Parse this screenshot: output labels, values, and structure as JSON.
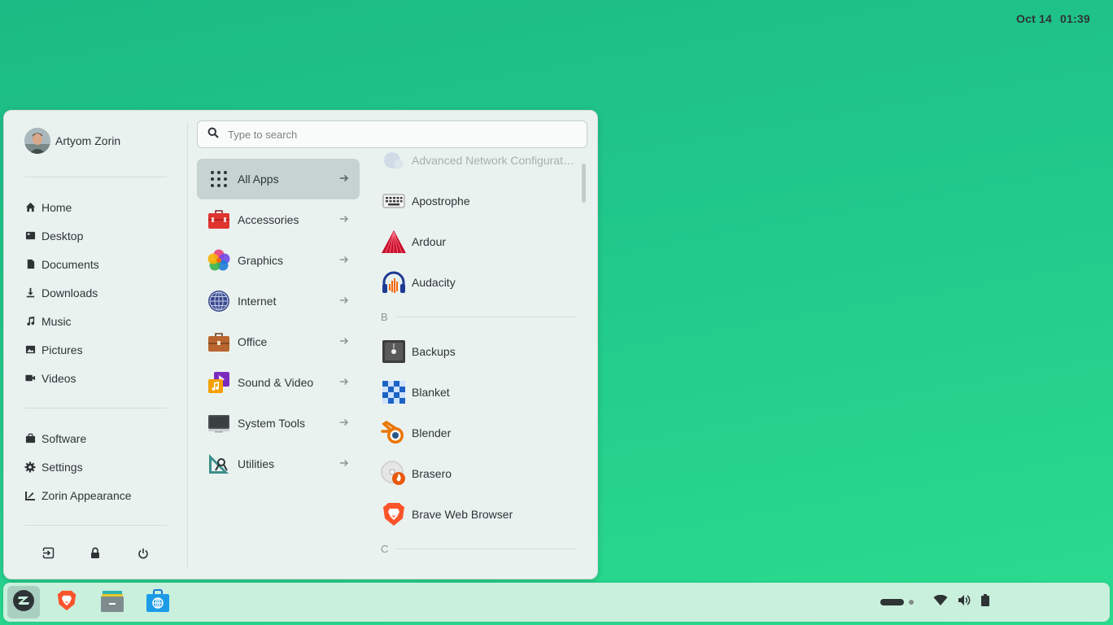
{
  "user": {
    "name": "Artyom Zorin"
  },
  "places": [
    {
      "label": "Home",
      "icon": "home-icon"
    },
    {
      "label": "Desktop",
      "icon": "desktop-icon"
    },
    {
      "label": "Documents",
      "icon": "document-icon"
    },
    {
      "label": "Downloads",
      "icon": "download-icon"
    },
    {
      "label": "Music",
      "icon": "music-icon"
    },
    {
      "label": "Pictures",
      "icon": "picture-icon"
    },
    {
      "label": "Videos",
      "icon": "video-icon"
    }
  ],
  "system": [
    {
      "label": "Software",
      "icon": "software-bag-icon"
    },
    {
      "label": "Settings",
      "icon": "gear-icon"
    },
    {
      "label": "Zorin Appearance",
      "icon": "appearance-icon"
    }
  ],
  "session": [
    "log-out-icon",
    "lock-icon",
    "power-icon"
  ],
  "search": {
    "placeholder": "Type to search"
  },
  "categories": [
    {
      "label": "All Apps",
      "active": true
    },
    {
      "label": "Accessories"
    },
    {
      "label": "Graphics"
    },
    {
      "label": "Internet"
    },
    {
      "label": "Office"
    },
    {
      "label": "Sound & Video"
    },
    {
      "label": "System Tools"
    },
    {
      "label": "Utilities"
    }
  ],
  "apps": {
    "partial_top": "Advanced Network Configurat…",
    "a_items": [
      "Apostrophe",
      "Ardour",
      "Audacity"
    ],
    "letter_b": "B",
    "b_items": [
      "Backups",
      "Blanket",
      "Blender",
      "Brasero",
      "Brave Web Browser"
    ],
    "letter_c": "C"
  },
  "taskbar": {
    "apps": [
      "zorin-menu-icon",
      "brave-icon",
      "files-icon",
      "software-store-icon"
    ],
    "date": "Oct 14",
    "time": "01:39"
  },
  "colors": {
    "desktop_top": "#1cba84",
    "desktop_bottom": "#2bdc8e",
    "menu_bg": "#eaf2f0",
    "active_category": "#c6d3d1",
    "taskbar": "#c9f0dc"
  }
}
